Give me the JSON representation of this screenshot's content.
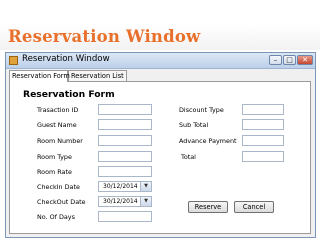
{
  "slide": {
    "title": "Reservation Window"
  },
  "window": {
    "title": "Reservation Window",
    "controls": {
      "minimize": "–",
      "maximize": "□",
      "close": "✕"
    }
  },
  "tabs": [
    "Reservation Form",
    "Reservation List"
  ],
  "form": {
    "heading": "Reservation Form",
    "labels": {
      "transaction_id": "Trasaction ID",
      "guest_name": "Guest Name",
      "room_number": "Room Number",
      "room_type": "Room Type",
      "room_rate": "Room Rate",
      "checkin_date": "CheckIn Date",
      "checkout_date": "CheckOut Date",
      "no_of_days": "No. Of Days",
      "discount_type": "Discount Type",
      "sub_total": "Sub Total",
      "advance_payment": "Advance Payment",
      "total": "Total"
    },
    "checkin_value": "30/12/2014",
    "checkout_value": "30/12/2014",
    "buttons": {
      "reserve": "Reserve",
      "cancel": "Cancel"
    }
  }
}
